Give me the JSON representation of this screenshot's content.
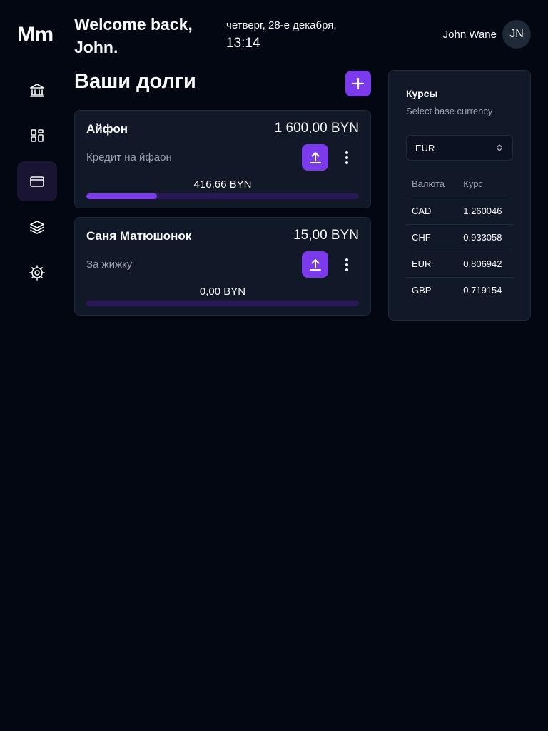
{
  "app": {
    "logo": "Mm"
  },
  "header": {
    "welcome": "Welcome back, John.",
    "date": "четверг, 28-е декабря,",
    "time": "13:14",
    "user_name": "John Wane",
    "user_initials": "JN"
  },
  "sidebar": {
    "items": [
      {
        "icon": "bank-icon",
        "active": false
      },
      {
        "icon": "dashboard-icon",
        "active": false
      },
      {
        "icon": "credit-card-icon",
        "active": true
      },
      {
        "icon": "layers-icon",
        "active": false
      },
      {
        "icon": "gear-icon",
        "active": false
      }
    ]
  },
  "main": {
    "title": "Ваши долги",
    "add_icon": "plus-icon",
    "debts": [
      {
        "name": "Айфон",
        "amount": "1 600,00 BYN",
        "description": "Кредит на йфаон",
        "paid": "416,66 BYN",
        "progress_fraction": 0.26
      },
      {
        "name": "Саня Матюшонок",
        "amount": "15,00 BYN",
        "description": "За жижку",
        "paid": "0,00 BYN",
        "progress_fraction": 0
      }
    ]
  },
  "rates": {
    "title": "Курсы",
    "subtitle": "Select base currency",
    "selected_currency": "EUR",
    "columns": [
      "Валюта",
      "Курс"
    ],
    "rows": [
      [
        "CAD",
        "1.260046"
      ],
      [
        "CHF",
        "0.933058"
      ],
      [
        "EUR",
        "0.806942"
      ],
      [
        "GBP",
        "0.719154"
      ]
    ]
  },
  "colors": {
    "background": "#030712",
    "card": "#111827",
    "accent": "#7c3aed",
    "progress_track": "#2a1858",
    "muted_text": "#9ca3af"
  }
}
